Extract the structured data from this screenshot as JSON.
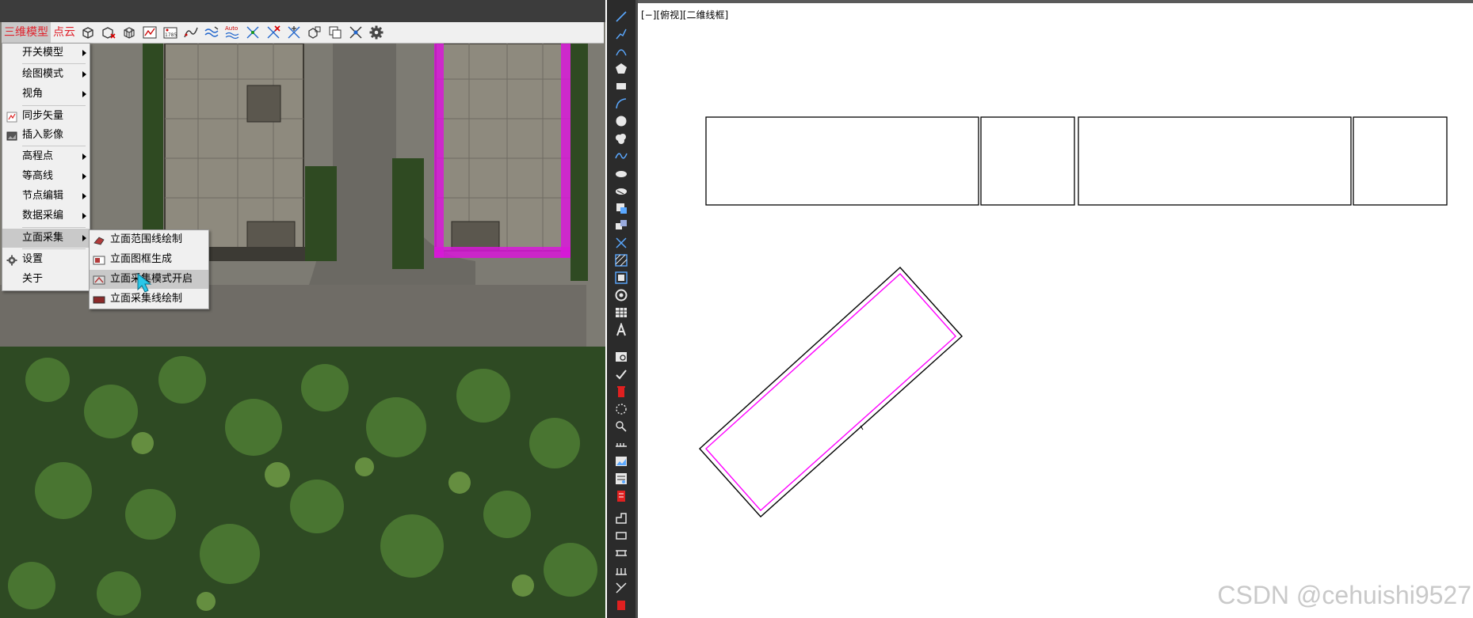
{
  "toolbar": {
    "menus": [
      {
        "label": "三维模型",
        "active": true
      },
      {
        "label": "点云",
        "active": false
      }
    ],
    "icons": [
      "cube-frame-icon",
      "cube-delete-icon",
      "cube-wire-icon",
      "chart-icon",
      "elevation-marker-icon",
      "curve-icon",
      "wave-icon",
      "auto-contour-icon",
      "node-edit-icon",
      "node-delete-icon",
      "node-move-icon",
      "model-copy-icon",
      "layer-icon",
      "snap-icon",
      "settings-gear-icon"
    ],
    "auto_label": "Auto",
    "marker_label": "1785"
  },
  "main_menu": {
    "items": [
      {
        "label": "开关模型",
        "submenu": true,
        "icon": ""
      },
      {
        "label": "绘图模式",
        "submenu": true,
        "icon": ""
      },
      {
        "label": "视角",
        "submenu": true,
        "icon": ""
      },
      {
        "label": "同步矢量",
        "submenu": false,
        "icon": "sync-vector-icon"
      },
      {
        "label": "插入影像",
        "submenu": false,
        "icon": "insert-image-icon"
      },
      {
        "label": "高程点",
        "submenu": true,
        "icon": ""
      },
      {
        "label": "等高线",
        "submenu": true,
        "icon": ""
      },
      {
        "label": "节点编辑",
        "submenu": true,
        "icon": ""
      },
      {
        "label": "数据采编",
        "submenu": true,
        "icon": ""
      },
      {
        "label": "立面采集",
        "submenu": true,
        "icon": "",
        "highlighted": true
      },
      {
        "label": "设置",
        "submenu": false,
        "icon": "settings-icon"
      },
      {
        "label": "关于",
        "submenu": false,
        "icon": ""
      }
    ]
  },
  "sub_menu": {
    "items": [
      {
        "label": "立面范围线绘制",
        "icon": "facade-range-icon"
      },
      {
        "label": "立面图框生成",
        "icon": "facade-frame-icon"
      },
      {
        "label": "立面采集模式开启",
        "icon": "facade-mode-icon",
        "highlighted": true
      },
      {
        "label": "立面采集线绘制",
        "icon": "facade-line-icon"
      }
    ]
  },
  "cad": {
    "view_label": "[−][俯视][二维线框]",
    "vertical_tools": [
      "line-icon",
      "polyline-icon",
      "arc-3pt-icon",
      "polygon-icon",
      "rectangle-icon",
      "arc-icon",
      "circle-icon",
      "revision-cloud-icon",
      "spline-icon",
      "ellipse-icon",
      "ellipse-arc-icon",
      "insert-block-icon",
      "make-block-icon",
      "point-icon",
      "hatch-icon",
      "gradient-icon",
      "region-icon",
      "table-icon",
      "text-icon",
      "field-icon",
      "attribute-icon",
      "erase-icon",
      "break-icon",
      "join-icon",
      "ruler-icon",
      "image-icon",
      "xref-icon",
      "red-marker-icon",
      "dim-linear-icon",
      "dim-rect-icon",
      "dim-continue-icon",
      "dim-baseline-icon",
      "dim-style-icon",
      "red-end-icon"
    ],
    "colors": {
      "outline": "#000000",
      "facade_line": "#ff00ff",
      "background": "#ffffff"
    }
  },
  "watermark": "CSDN @cehuishi9527"
}
